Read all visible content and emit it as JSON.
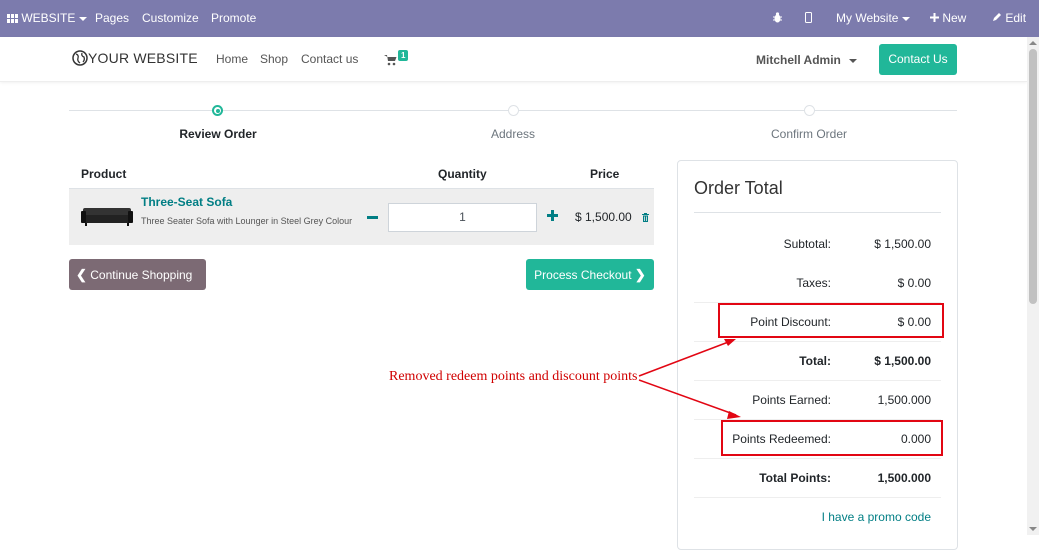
{
  "adminbar": {
    "app_menu": "WEBSITE",
    "pages": "Pages",
    "customize": "Customize",
    "promote": "Promote",
    "website_switch": "My Website",
    "new": "New",
    "edit": "Edit"
  },
  "navbar": {
    "brand": "YOUR WEBSITE",
    "links": [
      "Home",
      "Shop",
      "Contact us"
    ],
    "cart_count": "1",
    "user": "Mitchell Admin",
    "contact_button": "Contact Us"
  },
  "wizard": {
    "steps": [
      "Review Order",
      "Address",
      "Confirm Order"
    ],
    "active_step": 0
  },
  "cart": {
    "headers": {
      "product": "Product",
      "quantity": "Quantity",
      "price": "Price"
    },
    "line": {
      "name": "Three-Seat Sofa",
      "description": "Three Seater Sofa with Lounger in Steel Grey Colour",
      "quantity": "1",
      "price": "$ 1,500.00"
    },
    "continue_label": "Continue Shopping",
    "checkout_label": "Process Checkout"
  },
  "order_total": {
    "title": "Order Total",
    "rows": [
      {
        "label": "Subtotal:",
        "value": "$ 1,500.00"
      },
      {
        "label": "Taxes:",
        "value": "$ 0.00"
      },
      {
        "label": "Point Discount:",
        "value": "$ 0.00"
      },
      {
        "label": "Total:",
        "value": "$ 1,500.00"
      },
      {
        "label": "Points Earned:",
        "value": "1,500.000"
      },
      {
        "label": "Points Redeemed:",
        "value": "0.000"
      },
      {
        "label": "Total Points:",
        "value": "1,500.000"
      }
    ],
    "promo_link": "I have a promo code"
  },
  "annotation": {
    "text": "Removed redeem points and discount points",
    "color": "#d00000"
  },
  "colors": {
    "adminbar": "#7c7bad",
    "primary": "#21b799",
    "link": "#017e84",
    "secondary": "#7c6a74",
    "highlight": "#e20613"
  },
  "icons": [
    "apps-icon",
    "bug-icon",
    "mobile-icon",
    "plus-icon",
    "pencil-icon",
    "globe-icon",
    "cart-icon",
    "minus-icon",
    "plus-icon",
    "trash-icon",
    "chevron-left-icon",
    "chevron-right-icon",
    "caret-down-icon"
  ]
}
